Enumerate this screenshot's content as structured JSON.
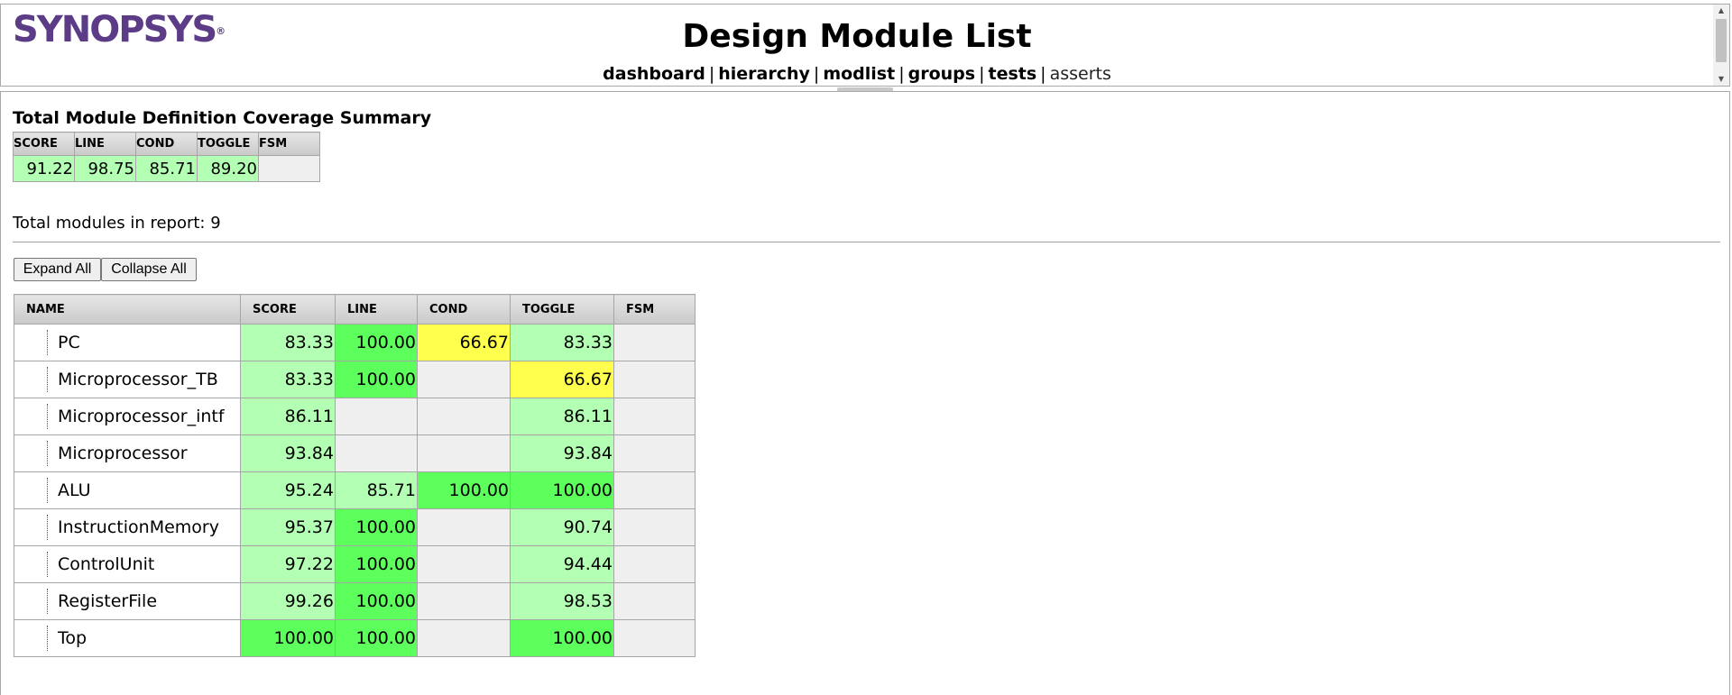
{
  "header": {
    "logo": "SYNOPSYS",
    "logo_mark": "®",
    "title": "Design Module List",
    "nav": [
      {
        "label": "dashboard",
        "bold": true
      },
      {
        "label": "hierarchy",
        "bold": true
      },
      {
        "label": "modlist",
        "bold": true
      },
      {
        "label": "groups",
        "bold": true
      },
      {
        "label": "tests",
        "bold": true
      },
      {
        "label": "asserts",
        "bold": false
      }
    ],
    "separator": "|"
  },
  "summary": {
    "title": "Total Module Definition Coverage Summary",
    "columns": [
      "SCORE",
      "LINE",
      "COND",
      "TOGGLE",
      "FSM"
    ],
    "values": [
      "91.22",
      "98.75",
      "85.71",
      "89.20",
      ""
    ]
  },
  "total_modules_text": "Total modules in report: 9",
  "buttons": {
    "expand": "Expand All",
    "collapse": "Collapse All"
  },
  "modules_table": {
    "columns": [
      "NAME",
      "SCORE",
      "LINE",
      "COND",
      "TOGGLE",
      "FSM"
    ],
    "rows": [
      {
        "name": "PC",
        "score": "83.33",
        "line": "100.00",
        "cond": "66.67",
        "toggle": "83.33",
        "fsm": ""
      },
      {
        "name": "Microprocessor_TB",
        "score": "83.33",
        "line": "100.00",
        "cond": "",
        "toggle": "66.67",
        "fsm": ""
      },
      {
        "name": "Microprocessor_intf",
        "score": "86.11",
        "line": "",
        "cond": "",
        "toggle": "86.11",
        "fsm": ""
      },
      {
        "name": "Microprocessor",
        "score": "93.84",
        "line": "",
        "cond": "",
        "toggle": "93.84",
        "fsm": ""
      },
      {
        "name": "ALU",
        "score": "95.24",
        "line": "85.71",
        "cond": "100.00",
        "toggle": "100.00",
        "fsm": ""
      },
      {
        "name": "InstructionMemory",
        "score": "95.37",
        "line": "100.00",
        "cond": "",
        "toggle": "90.74",
        "fsm": ""
      },
      {
        "name": "ControlUnit",
        "score": "97.22",
        "line": "100.00",
        "cond": "",
        "toggle": "94.44",
        "fsm": ""
      },
      {
        "name": "RegisterFile",
        "score": "99.26",
        "line": "100.00",
        "cond": "",
        "toggle": "98.53",
        "fsm": ""
      },
      {
        "name": "Top",
        "score": "100.00",
        "line": "100.00",
        "cond": "",
        "toggle": "100.00",
        "fsm": ""
      }
    ]
  },
  "colors": {
    "logo_purple": "#5c3b87",
    "coverage_high": "#5cff5c",
    "coverage_mid": "#b3ffb3",
    "coverage_low": "#ffff4d",
    "coverage_none": "#efefef"
  }
}
